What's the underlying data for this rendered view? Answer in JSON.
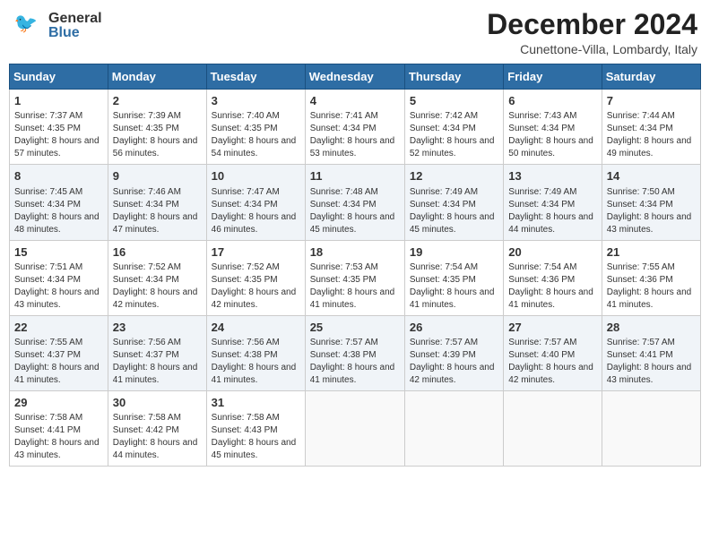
{
  "header": {
    "logo": {
      "general": "General",
      "blue": "Blue"
    },
    "title": "December 2024",
    "subtitle": "Cunettone-Villa, Lombardy, Italy"
  },
  "calendar": {
    "days_of_week": [
      "Sunday",
      "Monday",
      "Tuesday",
      "Wednesday",
      "Thursday",
      "Friday",
      "Saturday"
    ],
    "weeks": [
      [
        {
          "day": "1",
          "sunrise": "Sunrise: 7:37 AM",
          "sunset": "Sunset: 4:35 PM",
          "daylight": "Daylight: 8 hours and 57 minutes."
        },
        {
          "day": "2",
          "sunrise": "Sunrise: 7:39 AM",
          "sunset": "Sunset: 4:35 PM",
          "daylight": "Daylight: 8 hours and 56 minutes."
        },
        {
          "day": "3",
          "sunrise": "Sunrise: 7:40 AM",
          "sunset": "Sunset: 4:35 PM",
          "daylight": "Daylight: 8 hours and 54 minutes."
        },
        {
          "day": "4",
          "sunrise": "Sunrise: 7:41 AM",
          "sunset": "Sunset: 4:34 PM",
          "daylight": "Daylight: 8 hours and 53 minutes."
        },
        {
          "day": "5",
          "sunrise": "Sunrise: 7:42 AM",
          "sunset": "Sunset: 4:34 PM",
          "daylight": "Daylight: 8 hours and 52 minutes."
        },
        {
          "day": "6",
          "sunrise": "Sunrise: 7:43 AM",
          "sunset": "Sunset: 4:34 PM",
          "daylight": "Daylight: 8 hours and 50 minutes."
        },
        {
          "day": "7",
          "sunrise": "Sunrise: 7:44 AM",
          "sunset": "Sunset: 4:34 PM",
          "daylight": "Daylight: 8 hours and 49 minutes."
        }
      ],
      [
        {
          "day": "8",
          "sunrise": "Sunrise: 7:45 AM",
          "sunset": "Sunset: 4:34 PM",
          "daylight": "Daylight: 8 hours and 48 minutes."
        },
        {
          "day": "9",
          "sunrise": "Sunrise: 7:46 AM",
          "sunset": "Sunset: 4:34 PM",
          "daylight": "Daylight: 8 hours and 47 minutes."
        },
        {
          "day": "10",
          "sunrise": "Sunrise: 7:47 AM",
          "sunset": "Sunset: 4:34 PM",
          "daylight": "Daylight: 8 hours and 46 minutes."
        },
        {
          "day": "11",
          "sunrise": "Sunrise: 7:48 AM",
          "sunset": "Sunset: 4:34 PM",
          "daylight": "Daylight: 8 hours and 45 minutes."
        },
        {
          "day": "12",
          "sunrise": "Sunrise: 7:49 AM",
          "sunset": "Sunset: 4:34 PM",
          "daylight": "Daylight: 8 hours and 45 minutes."
        },
        {
          "day": "13",
          "sunrise": "Sunrise: 7:49 AM",
          "sunset": "Sunset: 4:34 PM",
          "daylight": "Daylight: 8 hours and 44 minutes."
        },
        {
          "day": "14",
          "sunrise": "Sunrise: 7:50 AM",
          "sunset": "Sunset: 4:34 PM",
          "daylight": "Daylight: 8 hours and 43 minutes."
        }
      ],
      [
        {
          "day": "15",
          "sunrise": "Sunrise: 7:51 AM",
          "sunset": "Sunset: 4:34 PM",
          "daylight": "Daylight: 8 hours and 43 minutes."
        },
        {
          "day": "16",
          "sunrise": "Sunrise: 7:52 AM",
          "sunset": "Sunset: 4:34 PM",
          "daylight": "Daylight: 8 hours and 42 minutes."
        },
        {
          "day": "17",
          "sunrise": "Sunrise: 7:52 AM",
          "sunset": "Sunset: 4:35 PM",
          "daylight": "Daylight: 8 hours and 42 minutes."
        },
        {
          "day": "18",
          "sunrise": "Sunrise: 7:53 AM",
          "sunset": "Sunset: 4:35 PM",
          "daylight": "Daylight: 8 hours and 41 minutes."
        },
        {
          "day": "19",
          "sunrise": "Sunrise: 7:54 AM",
          "sunset": "Sunset: 4:35 PM",
          "daylight": "Daylight: 8 hours and 41 minutes."
        },
        {
          "day": "20",
          "sunrise": "Sunrise: 7:54 AM",
          "sunset": "Sunset: 4:36 PM",
          "daylight": "Daylight: 8 hours and 41 minutes."
        },
        {
          "day": "21",
          "sunrise": "Sunrise: 7:55 AM",
          "sunset": "Sunset: 4:36 PM",
          "daylight": "Daylight: 8 hours and 41 minutes."
        }
      ],
      [
        {
          "day": "22",
          "sunrise": "Sunrise: 7:55 AM",
          "sunset": "Sunset: 4:37 PM",
          "daylight": "Daylight: 8 hours and 41 minutes."
        },
        {
          "day": "23",
          "sunrise": "Sunrise: 7:56 AM",
          "sunset": "Sunset: 4:37 PM",
          "daylight": "Daylight: 8 hours and 41 minutes."
        },
        {
          "day": "24",
          "sunrise": "Sunrise: 7:56 AM",
          "sunset": "Sunset: 4:38 PM",
          "daylight": "Daylight: 8 hours and 41 minutes."
        },
        {
          "day": "25",
          "sunrise": "Sunrise: 7:57 AM",
          "sunset": "Sunset: 4:38 PM",
          "daylight": "Daylight: 8 hours and 41 minutes."
        },
        {
          "day": "26",
          "sunrise": "Sunrise: 7:57 AM",
          "sunset": "Sunset: 4:39 PM",
          "daylight": "Daylight: 8 hours and 42 minutes."
        },
        {
          "day": "27",
          "sunrise": "Sunrise: 7:57 AM",
          "sunset": "Sunset: 4:40 PM",
          "daylight": "Daylight: 8 hours and 42 minutes."
        },
        {
          "day": "28",
          "sunrise": "Sunrise: 7:57 AM",
          "sunset": "Sunset: 4:41 PM",
          "daylight": "Daylight: 8 hours and 43 minutes."
        }
      ],
      [
        {
          "day": "29",
          "sunrise": "Sunrise: 7:58 AM",
          "sunset": "Sunset: 4:41 PM",
          "daylight": "Daylight: 8 hours and 43 minutes."
        },
        {
          "day": "30",
          "sunrise": "Sunrise: 7:58 AM",
          "sunset": "Sunset: 4:42 PM",
          "daylight": "Daylight: 8 hours and 44 minutes."
        },
        {
          "day": "31",
          "sunrise": "Sunrise: 7:58 AM",
          "sunset": "Sunset: 4:43 PM",
          "daylight": "Daylight: 8 hours and 45 minutes."
        },
        null,
        null,
        null,
        null
      ]
    ]
  }
}
